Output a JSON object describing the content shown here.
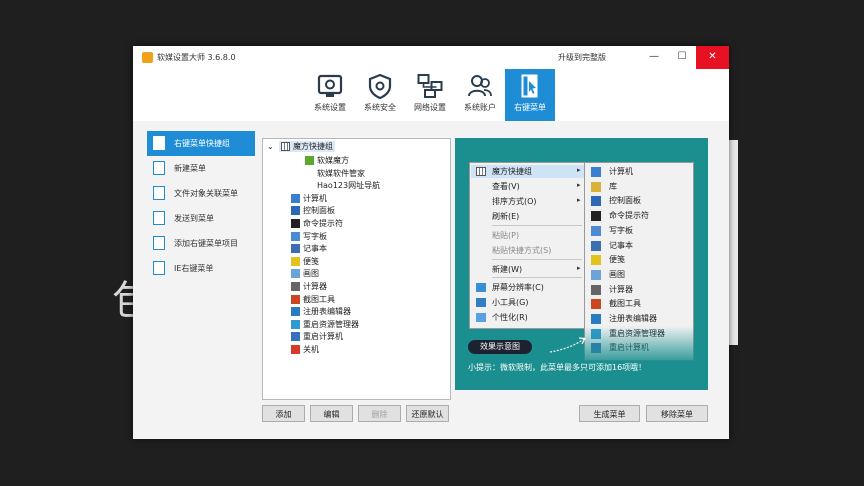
{
  "background": {
    "glyph": "包"
  },
  "window": {
    "title": "软媒设置大师 3.6.8.0",
    "upgrade_link": "升级到完整版",
    "controls": {
      "minimize": "—",
      "maximize": "☐",
      "close": "✕"
    },
    "accent_color": "#1f8dd6"
  },
  "toolbar": {
    "tabs": [
      {
        "label": "系统设置",
        "icon": "system-settings-icon"
      },
      {
        "label": "系统安全",
        "icon": "shield-icon"
      },
      {
        "label": "网络设置",
        "icon": "network-icon"
      },
      {
        "label": "系统账户",
        "icon": "users-icon"
      },
      {
        "label": "右键菜单",
        "icon": "cursor-menu-icon",
        "active": true
      }
    ]
  },
  "sidebar": {
    "items": [
      {
        "label": "右键菜单快捷组",
        "active": true
      },
      {
        "label": "新建菜单"
      },
      {
        "label": "文件对象关联菜单"
      },
      {
        "label": "发送到菜单"
      },
      {
        "label": "添加右键菜单项目"
      },
      {
        "label": "IE右键菜单"
      }
    ]
  },
  "tree": {
    "root": "魔方快捷组",
    "expander": "⌄",
    "children": [
      "软媒魔方",
      "软媒软件管家",
      "Hao123网址导航",
      "计算机",
      "控制面板",
      "命令提示符",
      "写字板",
      "记事本",
      "便笺",
      "画图",
      "计算器",
      "截图工具",
      "注册表编辑器",
      "重启资源管理器",
      "重启计算机",
      "关机"
    ]
  },
  "preview": {
    "menu1": {
      "items": [
        {
          "label": "魔方快捷组",
          "arrow": "▸",
          "highlight": true
        },
        {
          "label": "查看(V)",
          "arrow": "▸"
        },
        {
          "label": "排序方式(O)",
          "arrow": "▸"
        },
        {
          "label": "刷新(E)"
        },
        {
          "label": "粘贴(P)",
          "disabled": true
        },
        {
          "label": "粘贴快捷方式(S)",
          "disabled": true
        },
        {
          "label": "新建(W)",
          "arrow": "▸"
        },
        {
          "label": "屏幕分辨率(C)"
        },
        {
          "label": "小工具(G)"
        },
        {
          "label": "个性化(R)"
        }
      ]
    },
    "menu2": {
      "items": [
        "计算机",
        "库",
        "控制面板",
        "命令提示符",
        "写字板",
        "记事本",
        "便笺",
        "画图",
        "计算器",
        "截图工具",
        "注册表编辑器",
        "重启资源管理器",
        "重启计算机"
      ]
    },
    "effect_label": "效果示意图",
    "tip": "小提示：微软限制，此菜单最多只可添加16项哦！",
    "bg_color": "#1b8f8f"
  },
  "buttons": {
    "add": "添加",
    "edit": "编辑",
    "delete": "删除",
    "restore": "还原默认",
    "generate": "生成菜单",
    "remove": "移除菜单"
  }
}
